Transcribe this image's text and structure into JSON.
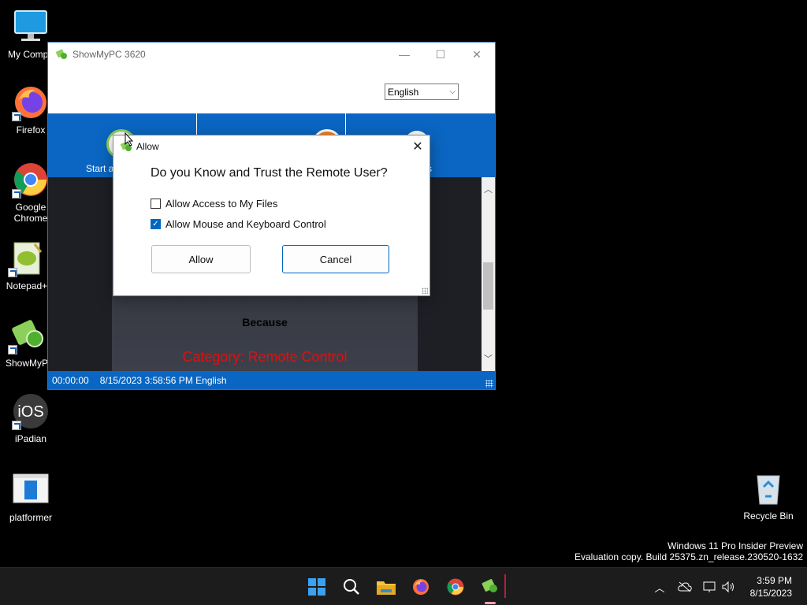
{
  "desktop": {
    "icons": [
      {
        "label": "My Compu"
      },
      {
        "label": "Firefox"
      },
      {
        "label": "Google Chrome"
      },
      {
        "label": "Notepad+"
      },
      {
        "label": "ShowMyP"
      },
      {
        "label": "iPadian"
      },
      {
        "label": "platformer"
      },
      {
        "label": "Recycle Bin"
      }
    ]
  },
  "window": {
    "title": "ShowMyPC 3620",
    "language": "English",
    "toolbar": [
      {
        "label": "Start a"
      },
      {
        "label": ""
      },
      {
        "label": "ns"
      }
    ],
    "content": {
      "because": "Because",
      "category": "Category: Remote Control"
    },
    "status": {
      "timer": "00:00:00",
      "info": "8/15/2023 3:58:56 PM English"
    }
  },
  "dialog": {
    "title": "Allow",
    "question": "Do you Know and Trust the Remote User?",
    "options": [
      {
        "label": "Allow Access to My Files",
        "checked": false
      },
      {
        "label": "Allow Mouse and Keyboard Control",
        "checked": true
      }
    ],
    "allow_label": "Allow",
    "cancel_label": "Cancel"
  },
  "watermark": {
    "line1": "Windows 11 Pro Insider Preview",
    "line2": "Evaluation copy. Build 25375.zn_release.230520-1632"
  },
  "taskbar": {
    "apps": [
      "start-icon",
      "search-icon",
      "file-explorer-icon",
      "firefox-icon",
      "chrome-icon",
      "showmypc-icon"
    ],
    "clock_time": "3:59 PM",
    "clock_date": "8/15/2023"
  },
  "colors": {
    "accent": "#0a66c2",
    "category_red": "#e01010",
    "checkbox_blue": "#0067c0"
  }
}
